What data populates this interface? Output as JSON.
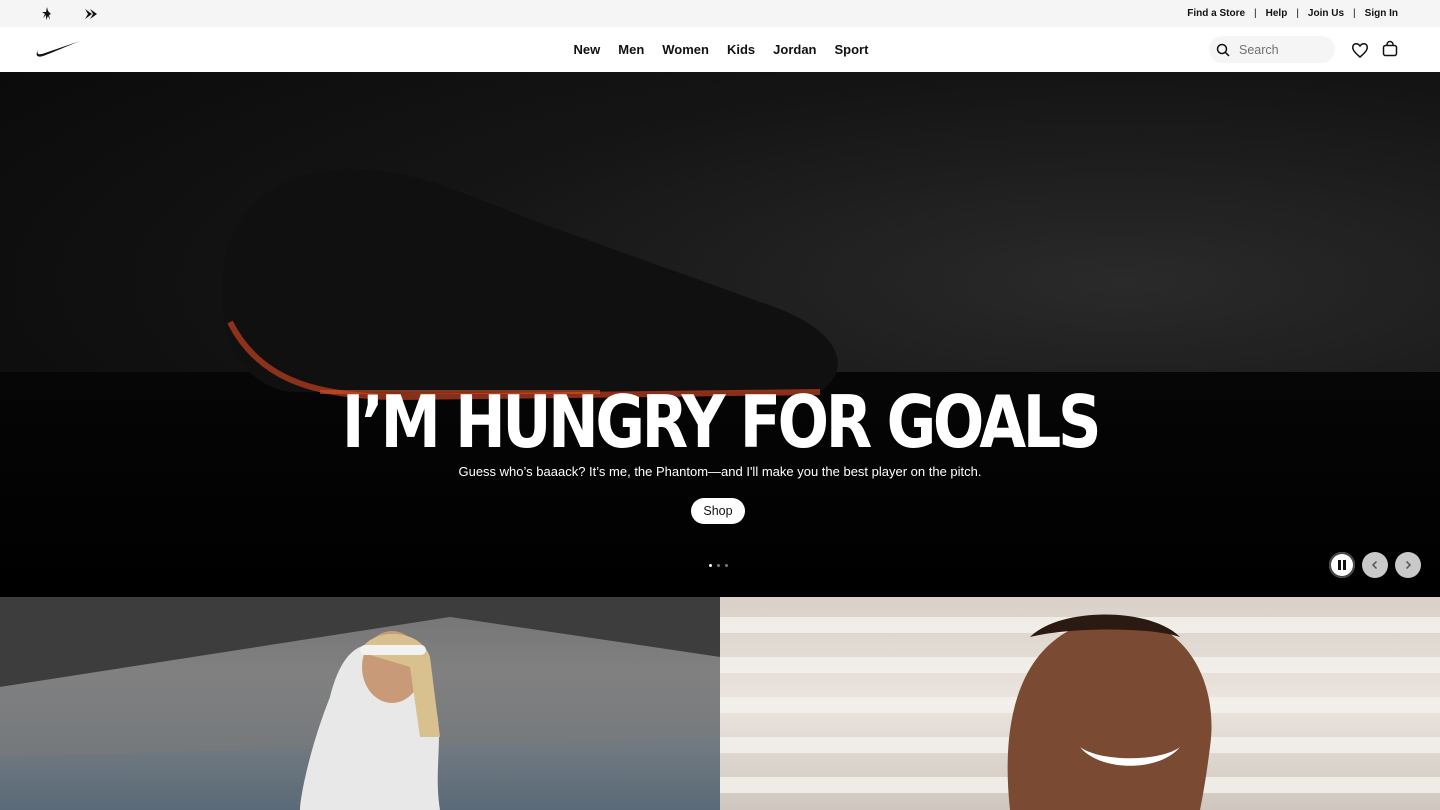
{
  "utility": {
    "brands": [
      "jordan-icon",
      "converse-icon"
    ],
    "links": [
      "Find a Store",
      "Help",
      "Join Us",
      "Sign In"
    ],
    "separator": "|"
  },
  "nav": {
    "logo": "nike-swoosh",
    "items": [
      "New",
      "Men",
      "Women",
      "Kids",
      "Jordan",
      "Sport"
    ],
    "search_placeholder": "Search"
  },
  "hero": {
    "title": "I’M HUNGRY FOR GOALS",
    "subtitle": "Guess who’s baaack? It’s me, the Phantom—and I'll make you the best player on the pitch.",
    "cta": "Shop",
    "slide_count": 3,
    "active_slide": 1
  },
  "colors": {
    "text": "#111111",
    "utility_bg": "#f5f5f5",
    "hero_bg": "#0a0a0a",
    "accent_orange": "#d2401f"
  }
}
